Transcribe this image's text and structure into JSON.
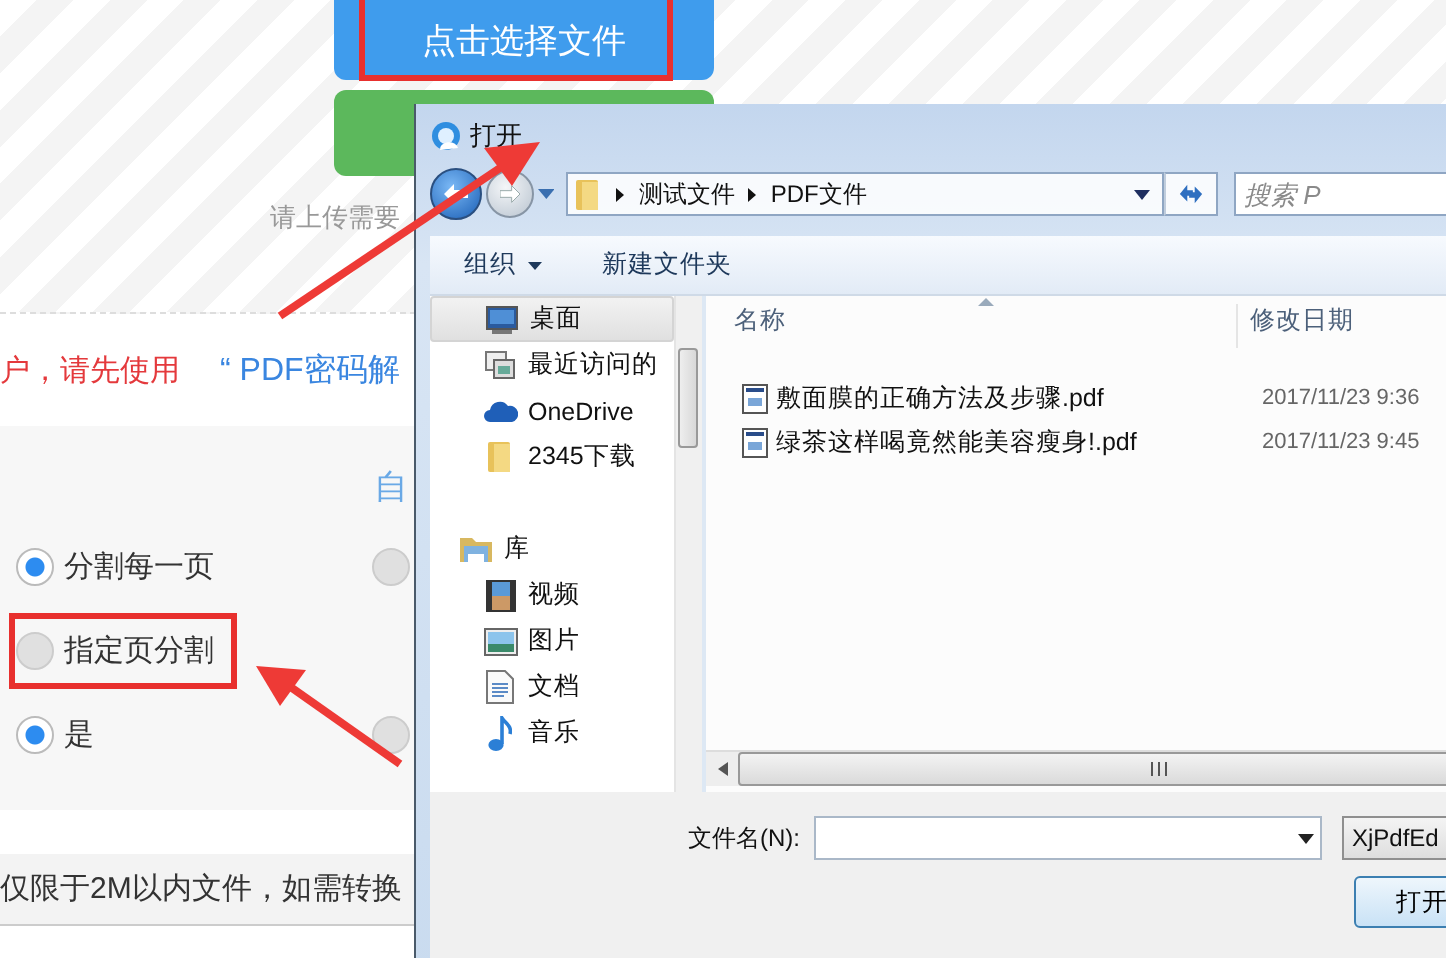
{
  "page": {
    "upload_button": "点击选择文件",
    "hint": "请上传需要",
    "notice": [
      {
        "kind": "warning",
        "text": "户，请先使用"
      },
      {
        "kind": "link",
        "text": "“ PDF密码解"
      }
    ],
    "options_heading": "自",
    "radio_rows": [
      {
        "options": [
          {
            "label": "分割每一页",
            "selected": true
          },
          {
            "selected": false
          }
        ]
      },
      {
        "options": [
          {
            "label": "指定页分割",
            "selected": false
          }
        ]
      },
      {
        "options": [
          {
            "label": "是",
            "selected": true
          },
          {
            "selected": false
          }
        ]
      }
    ],
    "footer_note": "仅限于2M以内文件，如需转换"
  },
  "dialog": {
    "title": "打开",
    "path": [
      "测试文件",
      "PDF文件"
    ],
    "search_placeholder": "搜索 P",
    "toolbar": [
      {
        "kind": "menu",
        "label": "组织"
      },
      {
        "kind": "button",
        "label": "新建文件夹"
      }
    ],
    "favorites": [
      {
        "label": "桌面",
        "kind": "desktop",
        "selected": true
      },
      {
        "label": "最近访问的",
        "kind": "recent",
        "selected": false
      },
      {
        "label": "OneDrive",
        "kind": "cloud",
        "selected": false
      },
      {
        "label": "2345下载",
        "kind": "folder",
        "selected": false
      }
    ],
    "libraries": {
      "label": "库",
      "kind": "library",
      "selected": false,
      "children": [
        {
          "label": "视频",
          "kind": "video",
          "selected": false
        },
        {
          "label": "图片",
          "kind": "image",
          "selected": false
        },
        {
          "label": "文档",
          "kind": "document",
          "selected": false
        },
        {
          "label": "音乐",
          "kind": "music",
          "selected": false
        }
      ]
    },
    "columns": [
      "名称",
      "修改日期"
    ],
    "files": [
      {
        "name": "敷面膜的正确方法及步骤.pdf",
        "modified": "2017/11/23 9:36"
      },
      {
        "name": "绿茶这样喝竟然能美容瘦身!.pdf",
        "modified": "2017/11/23 9:45"
      }
    ],
    "filename_label": "文件名(N):",
    "file_type": "XjPdfEd",
    "open_button": "打开"
  }
}
